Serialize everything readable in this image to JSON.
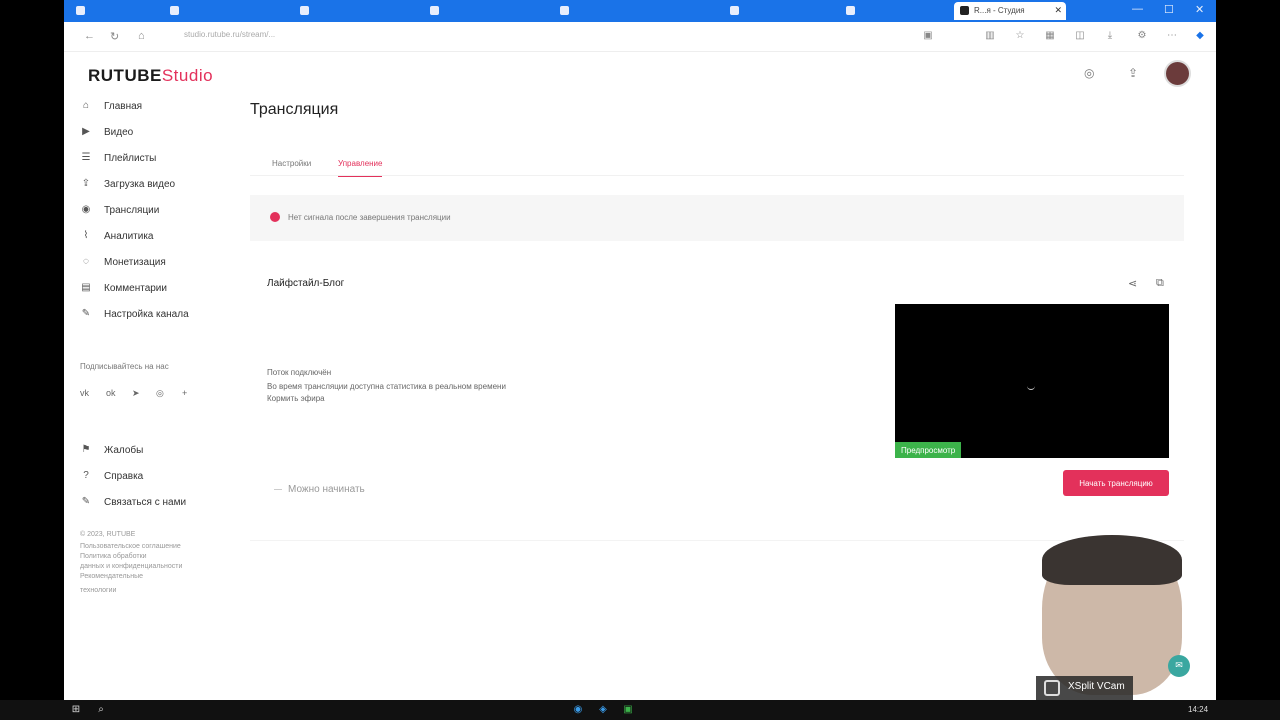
{
  "browser": {
    "tabs": [
      {
        "label": "",
        "active": false
      },
      {
        "label": "",
        "active": false
      },
      {
        "label": "",
        "active": false
      },
      {
        "label": "",
        "active": false
      },
      {
        "label": "",
        "active": false
      },
      {
        "label": "",
        "active": false
      },
      {
        "label": "",
        "active": false
      },
      {
        "label": "R...я - Студия",
        "active": true
      }
    ],
    "url": "studio.rutube.ru/stream/...",
    "nav": {
      "back": "←",
      "reload": "↻",
      "home": "⌂"
    },
    "window_controls": {
      "minimize": "—",
      "maximize": "☐",
      "close": "✕"
    },
    "tab_close": "✕"
  },
  "app": {
    "logo": {
      "rutube": "RUTUBE",
      "studio": "Studio"
    },
    "top_icons": {
      "bell": "◎",
      "upload": "⇪"
    }
  },
  "sidebar": {
    "items": [
      {
        "label": "Главная",
        "icon": "home-icon",
        "glyph": "⌂"
      },
      {
        "label": "Видео",
        "icon": "video-icon",
        "glyph": "▶"
      },
      {
        "label": "Плейлисты",
        "icon": "playlist-icon",
        "glyph": "☰"
      },
      {
        "label": "Загрузка видео",
        "icon": "upload-icon",
        "glyph": "⇪"
      },
      {
        "label": "Трансляции",
        "icon": "broadcast-icon",
        "glyph": "◉"
      },
      {
        "label": "Аналитика",
        "icon": "analytics-icon",
        "glyph": "⌇"
      },
      {
        "label": "Монетизация",
        "icon": "coin-icon",
        "glyph": "◌"
      },
      {
        "label": "Комментарии",
        "icon": "comment-icon",
        "glyph": "▤"
      },
      {
        "label": "Настройка канала",
        "icon": "settings-icon",
        "glyph": "✎"
      }
    ],
    "subscribe_heading": "Подписывайтесь на нас",
    "socials": [
      {
        "name": "vk-icon",
        "glyph": "vk"
      },
      {
        "name": "ok-icon",
        "glyph": "ok"
      },
      {
        "name": "telegram-icon",
        "glyph": "➤"
      },
      {
        "name": "viber-icon",
        "glyph": "◎"
      },
      {
        "name": "more-icon",
        "glyph": "+"
      }
    ],
    "secondary": [
      {
        "label": "Жалобы",
        "icon": "flag-icon",
        "glyph": "⚑"
      },
      {
        "label": "Справка",
        "icon": "help-icon",
        "glyph": "?"
      },
      {
        "label": "Связаться с нами",
        "icon": "contact-icon",
        "glyph": "✎"
      }
    ],
    "footer": [
      "© 2023, RUTUBE",
      "Пользовательское соглашение",
      "Политика обработки",
      "данных и конфиденциальности",
      "Рекомендательные",
      "технологии"
    ]
  },
  "page": {
    "title": "Трансляция",
    "tabs": [
      {
        "label": "Настройки",
        "active": false
      },
      {
        "label": "Управление",
        "active": true
      }
    ],
    "alert": "Нет сигнала после завершения трансляции"
  },
  "stream": {
    "title": "Лайфстайл-Блог",
    "status_lines": [
      "Поток подключён",
      "Во время трансляции доступна статистика в реальном времени",
      "Кормить эфира"
    ],
    "preview_badge": "Предпросмотр",
    "start_button": "Начать трансляцию",
    "ready_label": "Можно начинать",
    "share_icon": "share-icon",
    "open_icon": "external-link-icon"
  },
  "overlay": {
    "vcam_label": "XSplit VCam"
  },
  "taskbar": {
    "clock": "14:24"
  },
  "colors": {
    "accent": "#e3315b",
    "browser_tabbar": "#1a73e8",
    "preview_badge": "#3cb34a"
  }
}
